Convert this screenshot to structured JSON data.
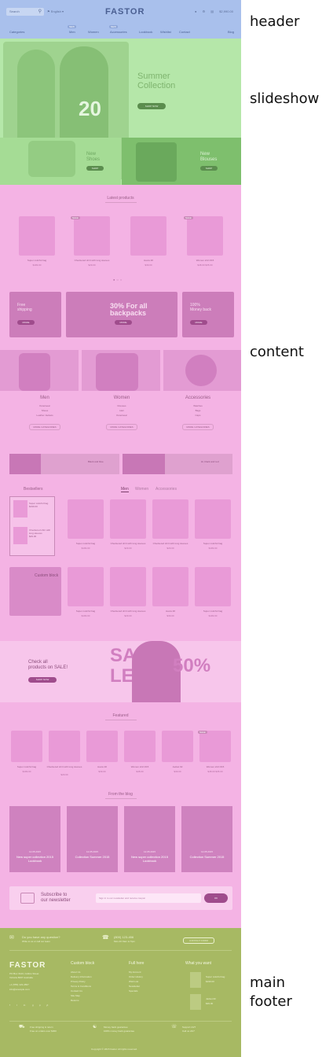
{
  "labels": {
    "header": "header",
    "slideshow": "slideshow",
    "content": "content",
    "footer_line1": "main",
    "footer_line2": "footer"
  },
  "header": {
    "search_placeholder": "Search",
    "language": "English",
    "logo": "FASTOR",
    "cart_total": "$2,990.00",
    "nav": [
      "Categories",
      "Men",
      "Women",
      "Accessories",
      "Lookbook",
      "Wishlist",
      "Contact",
      "Blog"
    ],
    "badge": "NEW"
  },
  "slideshow": {
    "hero_title_line1": "Summer",
    "hero_title_line2": "Collection",
    "hero_number": "20",
    "hero_button": "SHOP NOW",
    "tile1_line1": "New",
    "tile1_line2": "Shoes",
    "tile1_button": "SHOP",
    "tile2_line1": "New",
    "tile2_line2": "Blouses",
    "tile2_button": "SHOP"
  },
  "content": {
    "latest_title": "Latest products",
    "latest": [
      {
        "name": "Super colorful bag",
        "price": "$199.00"
      },
      {
        "name": "Checkered shirt with long sleeves",
        "price": "$29.00"
      },
      {
        "name": "Jeans #2",
        "price": "$39.00"
      },
      {
        "name": "Women shirt #15",
        "price": "$48.00 $35.00"
      }
    ],
    "sale_tag": "SALE",
    "promos": [
      {
        "text1": "Free",
        "text2": "shipping",
        "btn": "MORE"
      },
      {
        "text1": "30% For all",
        "text2": "backpacks",
        "btn": "MORE"
      },
      {
        "text1": "100%",
        "text2": "Money back",
        "btn": "MORE"
      }
    ],
    "categories": [
      {
        "name": "Men",
        "links": [
          "Outerwear",
          "Shoes",
          "Leather Jackets"
        ],
        "btn": "MORE CATEGORIES"
      },
      {
        "name": "Women",
        "links": [
          "Dresses",
          "Hair",
          "Outerwear"
        ],
        "btn": "MORE CATEGORIES"
      },
      {
        "name": "Accessories",
        "links": [
          "Watches",
          "Bags",
          "Caps"
        ],
        "btn": "MORE CATEGORIES"
      }
    ],
    "strip": [
      {
        "text": "Black and blue"
      },
      {
        "text": "Hi, black and red"
      }
    ],
    "bestsellers_title": "Bestsellers",
    "tabs": [
      "Men",
      "Women",
      "Accessories"
    ],
    "mini_items": [
      {
        "name": "Super colorful bag",
        "price": "$199.00"
      },
      {
        "name": "Checkered shirt with long sleeves",
        "price": "$29.00"
      }
    ],
    "bestsellers_row1": [
      {
        "name": "Super colorful bag",
        "price": "$199.00"
      },
      {
        "name": "Checkered shirt with long sleeves",
        "price": "$29.00"
      },
      {
        "name": "Checkered shirt with long sleeves",
        "price": "$29.00"
      },
      {
        "name": "Super colorful bag",
        "price": "$199.00"
      }
    ],
    "custom_block": "Custom block",
    "bestsellers_row2": [
      {
        "name": "Super colorful bag",
        "price": "$199.00"
      },
      {
        "name": "Checkered shirt with long sleeves",
        "price": "$29.00"
      },
      {
        "name": "Jeans #2",
        "price": "$39.00"
      },
      {
        "name": "Super colorful bag",
        "price": "$199.00"
      }
    ],
    "sale_banner_line1": "Check all",
    "sale_banner_line2": "products on SALE!",
    "sale_banner_button": "SHOP NOW",
    "sale_big1": "SA",
    "sale_big2": "LE",
    "sale_pct": "50%",
    "featured_title": "Featured",
    "featured": [
      {
        "name": "Super colorful bag",
        "price": "$199.00"
      },
      {
        "name": "Checkered shirt with long sleeves",
        "price": "$29.00"
      },
      {
        "name": "Jeans #2",
        "price": "$39.00"
      },
      {
        "name": "Women shirt #15",
        "price": "$48.00"
      },
      {
        "name": "Jacket #2",
        "price": "$39.00"
      },
      {
        "name": "Women shirt #15",
        "price": "$48.00 $35.00"
      }
    ],
    "blog_title": "From the blog",
    "blog": [
      {
        "date": "12.05.2015",
        "title": "New super collection 2015 Lookbook"
      },
      {
        "date": "12.05.2015",
        "title": "Collection Summer 2015"
      },
      {
        "date": "12.05.2015",
        "title": "New super collection 2015 Lookbook"
      },
      {
        "date": "12.05.2015",
        "title": "Collection Summer 2015"
      }
    ],
    "newsletter_line1": "Subscribe to",
    "newsletter_line2": "our newsletter",
    "newsletter_placeholder": "Sign in to our newsletter and receive coupon",
    "newsletter_button": "OK"
  },
  "footer": {
    "question": "Do you have any question?",
    "question_sub": "Write to us or call our team",
    "phone": "(800) 123-456",
    "phone_sub": "Mon-Fri 9am to 5pm",
    "contact_button": "CONTACT FORM",
    "logo": "FASTOR",
    "address1": "PO Box 3123, Collins Street",
    "address2": "Victoria 8007 Australia",
    "phone2": "+1 (555) 123-4567",
    "email": "info@example.com",
    "social": [
      "f",
      "t",
      "in",
      "g",
      "p",
      "yt"
    ],
    "col1_head": "Custom block",
    "col1_links": [
      "About Us",
      "Delivery Information",
      "Privacy Policy",
      "Terms & Conditions",
      "Contact Us",
      "Site Map",
      "Returns"
    ],
    "col2_head": "Full here",
    "col2_links": [
      "My Account",
      "Order History",
      "Wish List",
      "Newsletter",
      "Specials"
    ],
    "col3_head": "What you want",
    "col3_items": [
      {
        "name": "Super colorful bag",
        "price": "$199.00"
      },
      {
        "name": "Jacket #2",
        "price": "$39.00"
      }
    ],
    "feature1_title": "Free shipping & return",
    "feature1_sub": "Free on orders over $300",
    "feature2_title": "Money back guarantee",
    "feature2_sub": "100% money back guarantee",
    "feature3_title": "Support 24/7",
    "feature3_sub": "Call us 24/7",
    "copyright": "Copyright © 2015 Fastor. All rights reserved."
  }
}
